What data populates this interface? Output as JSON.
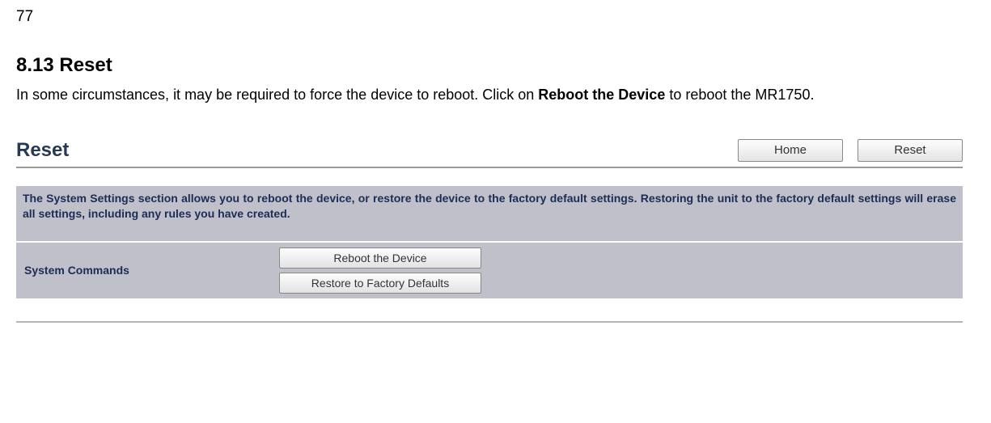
{
  "page_number": "77",
  "section": {
    "heading": "8.13 Reset"
  },
  "intro": {
    "pre": "In some circumstances, it may be required to force the device to reboot. Click on ",
    "bold": "Reboot the Device",
    "post": " to reboot the MR1750."
  },
  "panel": {
    "title": "Reset",
    "top_buttons": {
      "home": "Home",
      "reset": "Reset"
    },
    "description": "The System Settings section allows you to reboot the device, or restore the device to the factory default settings. Restoring the unit to the factory default settings will erase all settings, including any rules you have created.",
    "row": {
      "label": "System Commands",
      "reboot_btn": "Reboot the Device",
      "restore_btn": "Restore to Factory Defaults"
    }
  }
}
